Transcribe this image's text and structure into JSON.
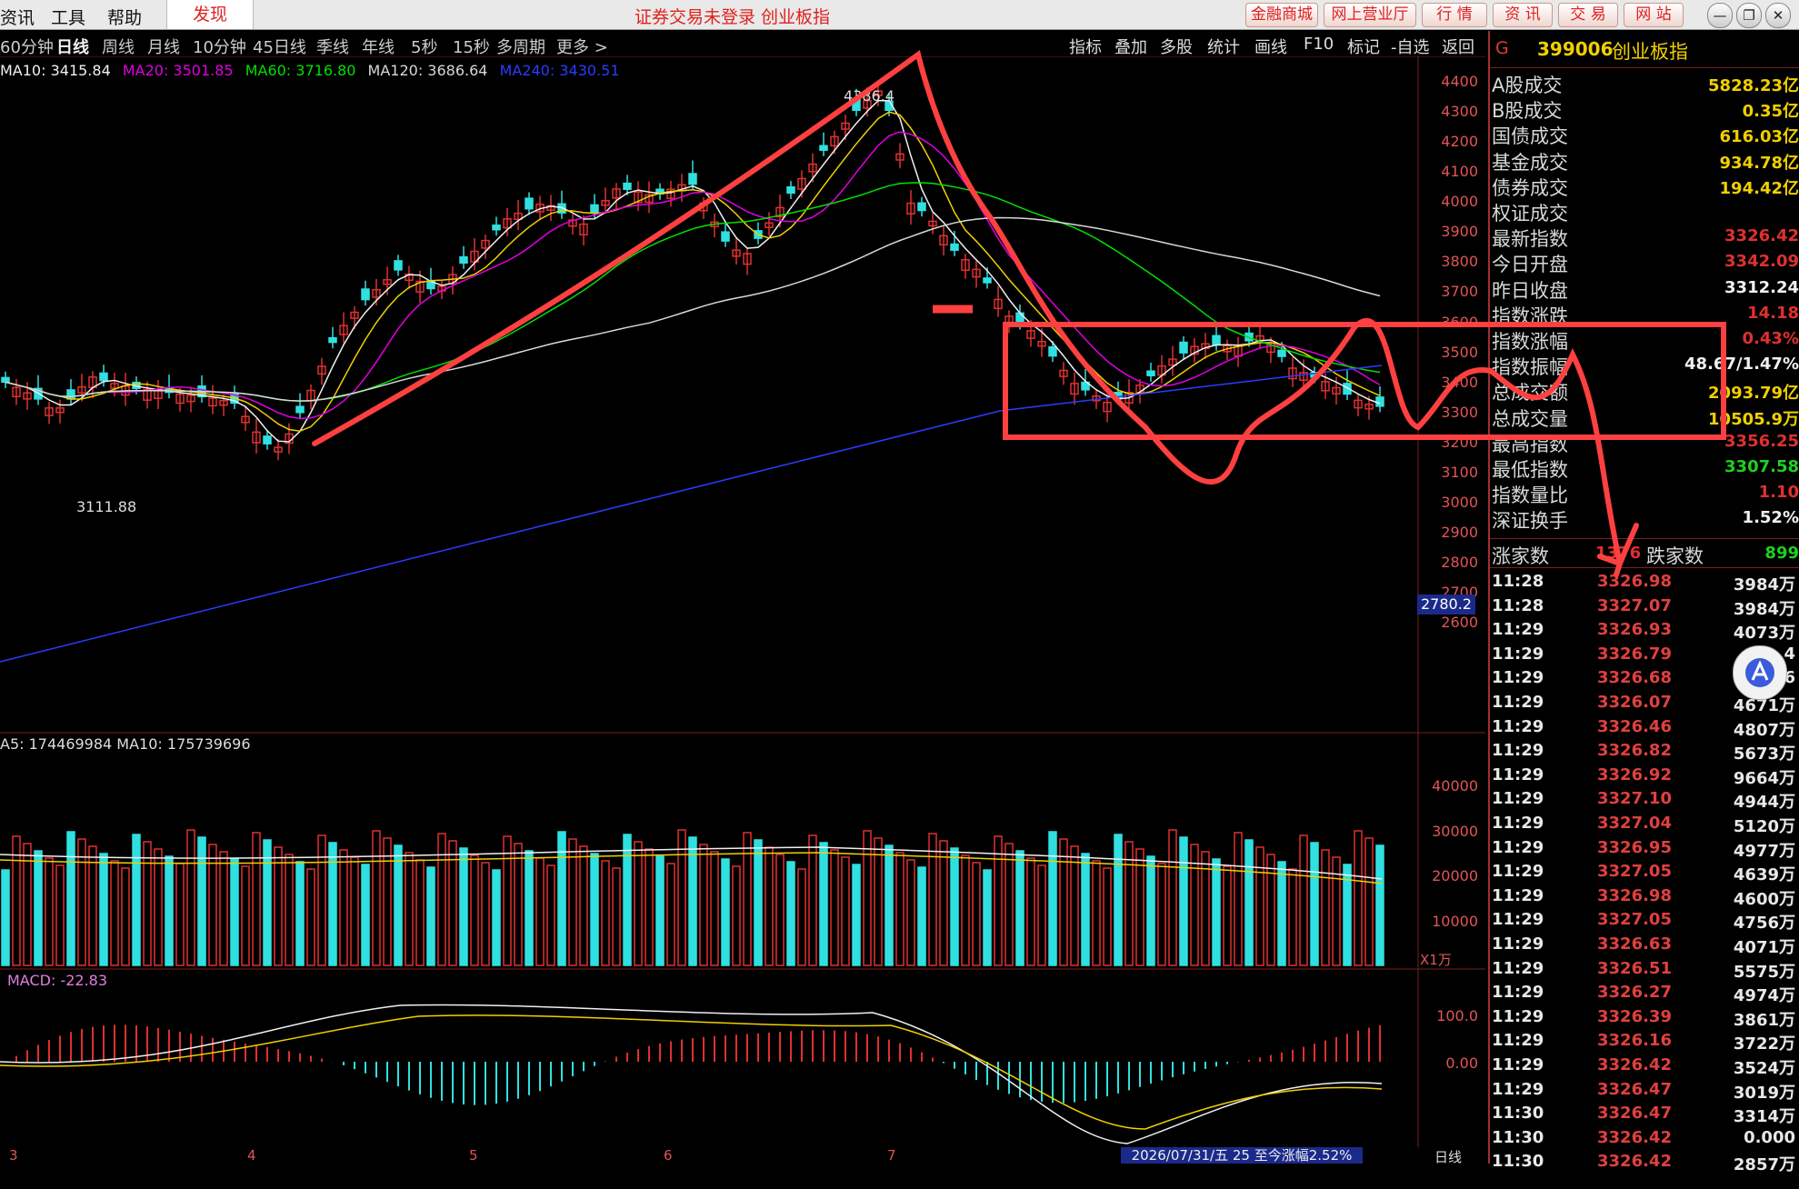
{
  "menubar": {
    "items": [
      "资讯",
      "工具",
      "帮助"
    ],
    "find_label": "发现",
    "status_message": "证券交易未登录  创业板指",
    "right_buttons": [
      "金融商城",
      "网上营业厅",
      "行 情",
      "资 讯",
      "交 易",
      "网 站"
    ],
    "window_buttons": [
      "—",
      "❐",
      "✕"
    ]
  },
  "periods": {
    "items": [
      "60分钟",
      "日线",
      "周线",
      "月线",
      "10分钟",
      "45日线",
      "季线",
      "年线",
      "5秒",
      "15秒",
      "多周期",
      "更多 >"
    ],
    "active": "日线"
  },
  "tools": [
    "指标",
    "叠加",
    "多股",
    "统计",
    "画线",
    "F10",
    "标记",
    "-自选",
    "返回"
  ],
  "ma_legend": [
    {
      "text": "MA10: 3415.84",
      "color": "#f0f0f0"
    },
    {
      "text": "MA20: 3501.85",
      "color": "#e000e0"
    },
    {
      "text": "MA60: 3716.80",
      "color": "#00e000"
    },
    {
      "text": "MA120: 3686.64",
      "color": "#d8d8d8"
    },
    {
      "text": "MA240: 3430.51",
      "color": "#2a3cff"
    }
  ],
  "price_axis": [
    "4400",
    "4300",
    "4200",
    "4100",
    "4000",
    "3900",
    "3800",
    "3700",
    "3600",
    "3500",
    "3400",
    "3300",
    "3200",
    "3100",
    "3000",
    "2900",
    "2800",
    "2700",
    "2600"
  ],
  "price_tag": "2780.2",
  "chart_annotations": {
    "high": "4386.4",
    "low": "3111.88"
  },
  "volume": {
    "legend": "A5: 174469984  MA10: 175739696",
    "axis": [
      "40000",
      "30000",
      "20000",
      "10000"
    ],
    "unit": "X1万"
  },
  "macd": {
    "legend": "MACD: -22.83",
    "axis": [
      "100.0",
      "0.00"
    ]
  },
  "x_labels": [
    "3",
    "4",
    "5",
    "6",
    "7"
  ],
  "status_band": "2026/07/31/五  25 至今涨幅2.52%",
  "period_caption": "日线",
  "right_panel": {
    "g_label": "G",
    "code": "399006",
    "name": "创业板指",
    "stats": [
      {
        "k": "A股成交",
        "v": "5828.23亿",
        "c": "#f0d000"
      },
      {
        "k": "B股成交",
        "v": "0.35亿",
        "c": "#f0d000"
      },
      {
        "k": "国债成交",
        "v": "616.03亿",
        "c": "#f0d000"
      },
      {
        "k": "基金成交",
        "v": "934.78亿",
        "c": "#f0d000"
      },
      {
        "k": "债券成交",
        "v": "194.42亿",
        "c": "#f0d000"
      },
      {
        "k": "权证成交",
        "v": "",
        "c": "#f0d000"
      },
      {
        "k": "最新指数",
        "v": "3326.42",
        "c": "#e03030"
      },
      {
        "k": "今日开盘",
        "v": "3342.09",
        "c": "#e03030"
      },
      {
        "k": "昨日收盘",
        "v": "3312.24",
        "c": "#f0f0f0"
      },
      {
        "k": "指数涨跌",
        "v": "14.18",
        "c": "#e03030"
      },
      {
        "k": "指数涨幅",
        "v": "0.43%",
        "c": "#e03030"
      },
      {
        "k": "指数振幅",
        "v": "48.67/1.47%",
        "c": "#f0f0f0"
      },
      {
        "k": "总成交额",
        "v": "2093.79亿",
        "c": "#f0d000"
      },
      {
        "k": "总成交量",
        "v": "10505.9万",
        "c": "#f0d000"
      },
      {
        "k": "最高指数",
        "v": "3356.25",
        "c": "#e03030"
      },
      {
        "k": "最低指数",
        "v": "3307.58",
        "c": "#20d020"
      },
      {
        "k": "指数量比",
        "v": "1.10",
        "c": "#e03030"
      },
      {
        "k": "深证换手",
        "v": "1.52%",
        "c": "#f0f0f0"
      }
    ],
    "breadth": {
      "up_label": "涨家数",
      "up_value": "1376",
      "down_label": "跌家数",
      "down_value": "899"
    },
    "ticks": [
      {
        "t": "11:28",
        "p": "3326.98",
        "v": "3984万"
      },
      {
        "t": "11:28",
        "p": "3327.07",
        "v": "3984万"
      },
      {
        "t": "11:29",
        "p": "3326.93",
        "v": "4073万"
      },
      {
        "t": "11:29",
        "p": "3326.79",
        "v": "4"
      },
      {
        "t": "11:29",
        "p": "3326.68",
        "v": "6"
      },
      {
        "t": "11:29",
        "p": "3326.07",
        "v": "4671万"
      },
      {
        "t": "11:29",
        "p": "3326.46",
        "v": "4807万"
      },
      {
        "t": "11:29",
        "p": "3326.82",
        "v": "5673万"
      },
      {
        "t": "11:29",
        "p": "3326.92",
        "v": "9664万"
      },
      {
        "t": "11:29",
        "p": "3327.10",
        "v": "4944万"
      },
      {
        "t": "11:29",
        "p": "3327.04",
        "v": "5120万"
      },
      {
        "t": "11:29",
        "p": "3326.95",
        "v": "4977万"
      },
      {
        "t": "11:29",
        "p": "3327.05",
        "v": "4639万"
      },
      {
        "t": "11:29",
        "p": "3326.98",
        "v": "4600万"
      },
      {
        "t": "11:29",
        "p": "3327.05",
        "v": "4756万"
      },
      {
        "t": "11:29",
        "p": "3326.63",
        "v": "4071万"
      },
      {
        "t": "11:29",
        "p": "3326.51",
        "v": "5575万"
      },
      {
        "t": "11:29",
        "p": "3326.27",
        "v": "4974万"
      },
      {
        "t": "11:29",
        "p": "3326.39",
        "v": "3861万"
      },
      {
        "t": "11:29",
        "p": "3326.16",
        "v": "3722万"
      },
      {
        "t": "11:29",
        "p": "3326.42",
        "v": "3524万"
      },
      {
        "t": "11:29",
        "p": "3326.47",
        "v": "3019万"
      },
      {
        "t": "11:30",
        "p": "3326.47",
        "v": "3314万"
      },
      {
        "t": "11:30",
        "p": "3326.42",
        "v": "0.000"
      },
      {
        "t": "11:30",
        "p": "3326.42",
        "v": "2857万"
      }
    ]
  },
  "colors": {
    "up": "#e03030",
    "down": "#30e0e0",
    "grid": "#7a1f1f",
    "annotation": "#ff4040"
  }
}
